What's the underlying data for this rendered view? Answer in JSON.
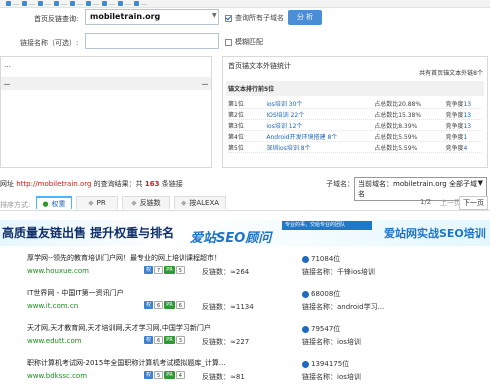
{
  "bookmarks": [
    {
      "label": "…"
    },
    {
      "label": "…"
    },
    {
      "label": "…"
    },
    {
      "label": "…"
    },
    {
      "label": "…"
    },
    {
      "label": "…"
    },
    {
      "label": "…"
    },
    {
      "label": "…"
    },
    {
      "label": "…"
    }
  ],
  "form": {
    "domain_label": "首页反链查询:",
    "domain_value": "mobiletrain.org",
    "check_all_label": "查询所有子域名",
    "submit_label": "分 析",
    "link_name_label": "链接名称（可选）:",
    "link_name_value": "",
    "fuzzy_label": "模糊匹配"
  },
  "left_panel": {
    "title": "…",
    "col1": "…",
    "col2": "…"
  },
  "right_panel": {
    "title": "首页锚文本外链统计",
    "total": "共有首页锚文本外链8个",
    "subtitle": "锚文本排行前5位",
    "rows": [
      {
        "rank": "第1位",
        "name": "ios培训 30个",
        "ratio": "占总数比20.88%",
        "comp": "竞争度",
        "comp_val": "13"
      },
      {
        "rank": "第2位",
        "name": "IOS培训 22个",
        "ratio": "占总数比15.38%",
        "comp": "竞争度",
        "comp_val": "13"
      },
      {
        "rank": "第3位",
        "name": "ios培训 12个",
        "ratio": "占总数比8.39%",
        "comp": "竞争度",
        "comp_val": "13"
      },
      {
        "rank": "第4位",
        "name": "Android开发环境搭建 8个",
        "ratio": "占总数比5.59%",
        "comp": "竞争度",
        "comp_val": "1"
      },
      {
        "rank": "第5位",
        "name": "深圳ios培训 8个",
        "ratio": "占总数比5.59%",
        "comp": "竞争度",
        "comp_val": "4"
      }
    ]
  },
  "summary": {
    "prefix": "网址",
    "url": "http://mobiletrain.org",
    "mid": "的查询结果：共",
    "count": "163",
    "suffix": "条链接",
    "subdomain_label": "子域名：",
    "subdomain_value": "当前域名：mobiletrain.org 全部子域名"
  },
  "sort": {
    "label": "排序方式:",
    "tabs": [
      "权重",
      "PR",
      "反链数",
      "按ALEXA"
    ],
    "pager": "1/2",
    "prev": "上一页",
    "next": "下一页"
  },
  "banner": {
    "left": "高质量友链出售 提升权重与排名",
    "logo": "爱站SEO顾问",
    "slogan": "专业的事，交给专业的团队",
    "right": "爱站网实战SEO培训"
  },
  "results": [
    {
      "title": "厚学网--领先的教育培训门户网！最专业的网上培训课程超市！",
      "url": "www.houxue.com",
      "weight": "7",
      "pr": "5",
      "backlinks": "反链数：≈264",
      "alexa": "71084位",
      "anchor_label": "链接名称：",
      "anchor": "千锋ios培训"
    },
    {
      "title": "IT世界网 - 中国IT第一资讯门户",
      "url": "www.it.com.cn",
      "weight": "6",
      "pr": "6",
      "backlinks": "反链数：≈1134",
      "alexa": "68008位",
      "anchor_label": "链接名称：",
      "anchor": "android学习..."
    },
    {
      "title": "天才网,天才教育网,天才培训网,天才学习网,中国学习新门户",
      "url": "www.edutt.com",
      "weight": "6",
      "pr": "3",
      "backlinks": "反链数：≈227",
      "alexa": "79547位",
      "anchor_label": "链接名称：",
      "anchor": "ios培训"
    },
    {
      "title": "职称计算机考试网-2015年全国职称计算机考试模拟题库_计算...",
      "url": "www.bdkssc.com",
      "weight": "5",
      "pr": "4",
      "backlinks": "反链数：≈81",
      "alexa": "1394175位",
      "anchor_label": "链接名称：",
      "anchor": "ios培训"
    }
  ]
}
